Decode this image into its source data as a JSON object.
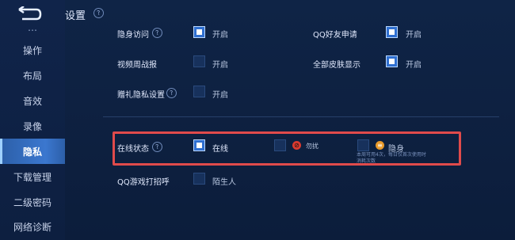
{
  "sidebar": {
    "items": [
      {
        "label": "…"
      },
      {
        "label": "操作"
      },
      {
        "label": "布局"
      },
      {
        "label": "音效"
      },
      {
        "label": "录像"
      },
      {
        "label": "隐私"
      },
      {
        "label": "下载管理"
      },
      {
        "label": "二级密码"
      },
      {
        "label": "网络诊断"
      }
    ]
  },
  "header": {
    "title": "设置"
  },
  "settings": {
    "hidden_visit": {
      "label": "隐身访问",
      "value": "开启",
      "checked": true
    },
    "qq_friend_request": {
      "label": "QQ好友申请",
      "value": "开启",
      "checked": true
    },
    "video_battle_report": {
      "label": "视频周战报",
      "value": "开启",
      "checked": false
    },
    "show_all_skins": {
      "label": "全部皮肤显示",
      "value": "开启",
      "checked": true
    },
    "gift_privacy": {
      "label": "赠礼隐私设置",
      "value": "开启",
      "checked": false
    },
    "online_status": {
      "label": "在线状态",
      "options": [
        {
          "label": "在线",
          "checked": true
        },
        {
          "label": "勿扰",
          "checked": false,
          "icon": "no-entry-icon"
        },
        {
          "label": "隐身",
          "checked": false,
          "icon": "invisible-icon"
        }
      ],
      "note": "本周可用4次，每日仅首次使用时消耗次数"
    },
    "qq_game_greeting": {
      "label": "QQ游戏打招呼",
      "value": "陌生人",
      "checked": false
    }
  },
  "colors": {
    "accent": "#2f6fd0",
    "highlight": "#e04b4b",
    "dnd": "#d93a2f",
    "invisible": "#e89a2a"
  }
}
